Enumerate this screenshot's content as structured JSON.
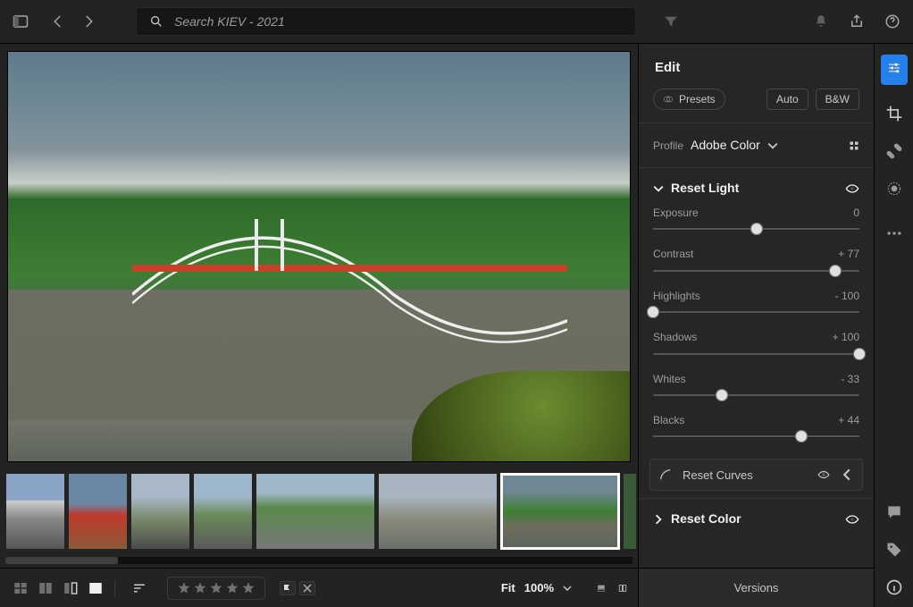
{
  "search": {
    "placeholder": "Search KIEV - 2021"
  },
  "edit": {
    "title": "Edit",
    "presets": "Presets",
    "auto": "Auto",
    "bw": "B&W",
    "profile_label": "Profile",
    "profile_value": "Adobe Color",
    "light_section": "Reset Light",
    "curves": "Reset Curves",
    "color_section": "Reset Color",
    "versions": "Versions",
    "sliders": {
      "exposure": {
        "label": "Exposure",
        "display": "0",
        "pct": 50
      },
      "contrast": {
        "label": "Contrast",
        "display": "+ 77",
        "pct": 88.5
      },
      "highlights": {
        "label": "Highlights",
        "display": "- 100",
        "pct": 0
      },
      "shadows": {
        "label": "Shadows",
        "display": "+ 100",
        "pct": 100
      },
      "whites": {
        "label": "Whites",
        "display": "- 33",
        "pct": 33.5
      },
      "blacks": {
        "label": "Blacks",
        "display": "+ 44",
        "pct": 72
      }
    }
  },
  "zoom": {
    "fit": "Fit",
    "pct": "100%"
  }
}
